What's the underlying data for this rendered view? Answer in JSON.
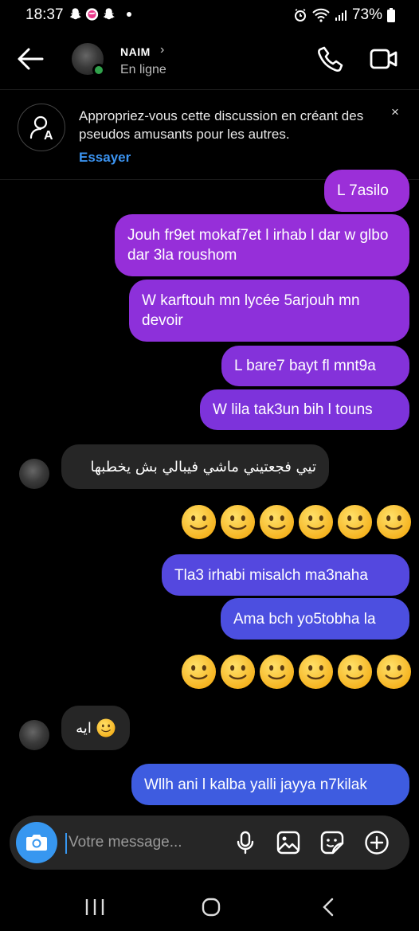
{
  "status": {
    "time": "18:37",
    "battery": "73%"
  },
  "header": {
    "name": "NAIM",
    "chevron": "›",
    "presence": "En ligne"
  },
  "banner": {
    "text": "Appropriez-vous cette discussion en créant des pseudos amusants pour les autres.",
    "action": "Essayer",
    "close": "×"
  },
  "messages": [
    {
      "from": "me",
      "text": "L 7asilo"
    },
    {
      "from": "me",
      "text": "Jouh fr9et mokaf7et l irhab l dar w glbo dar 3la roushom"
    },
    {
      "from": "me",
      "text": "W karftouh mn lycée 5arjouh mn devoir"
    },
    {
      "from": "me",
      "text": "L bare7 bayt fl mnt9a"
    },
    {
      "from": "me",
      "text": "W lila tak3un bih l touns"
    },
    {
      "from": "them",
      "text": "تيي فجعتيني ماشي فيبالي بش يخطبها"
    },
    {
      "from": "me",
      "emoji": "slightly-smiling-face",
      "count": 6
    },
    {
      "from": "me",
      "text": "Tla3 irhabi misalch ma3naha"
    },
    {
      "from": "me",
      "text": "Ama bch yo5tobha la"
    },
    {
      "from": "me",
      "emoji": "slightly-smiling-face",
      "count": 6
    },
    {
      "from": "them",
      "text": "ايه"
    },
    {
      "from": "me",
      "text": "Wllh ani l kalba yalli jayya n7kilak"
    }
  ],
  "composer": {
    "placeholder": "Votre message..."
  },
  "colors": {
    "sent_top": "#9b2fd8",
    "sent_bottom": "#3e5ce0",
    "received": "#262626",
    "accent": "#3797f0",
    "online": "#31a24c"
  },
  "icons": [
    "back-arrow-icon",
    "phone-icon",
    "video-icon",
    "nickname-icon",
    "close-icon",
    "camera-icon",
    "mic-icon",
    "image-icon",
    "sticker-icon",
    "plus-icon",
    "recent-apps-icon",
    "home-icon",
    "back-nav-icon"
  ]
}
